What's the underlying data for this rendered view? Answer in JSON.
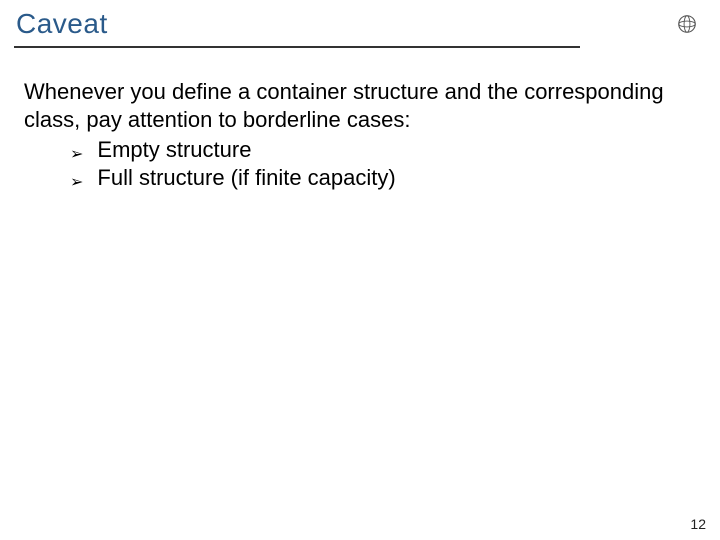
{
  "title": "Caveat",
  "intro": "Whenever you define a container structure and the corresponding class, pay attention to borderline cases:",
  "bullets": [
    "Empty structure",
    "Full structure (if finite capacity)"
  ],
  "page_number": "12",
  "logo_name": "sphere-logo"
}
